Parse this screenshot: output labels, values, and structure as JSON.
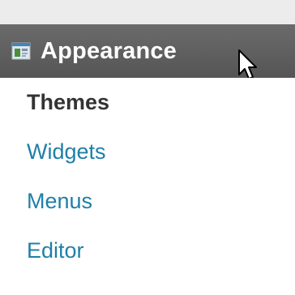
{
  "menu": {
    "header": {
      "label": "Appearance",
      "icon": "appearance-icon"
    },
    "items": [
      {
        "label": "Themes",
        "current": true
      },
      {
        "label": "Widgets",
        "current": false
      },
      {
        "label": "Menus",
        "current": false
      },
      {
        "label": "Editor",
        "current": false
      }
    ]
  },
  "colors": {
    "header_bg": "#5f5f5f",
    "header_text": "#ffffff",
    "link": "#1f7fa8",
    "current": "#333333"
  }
}
